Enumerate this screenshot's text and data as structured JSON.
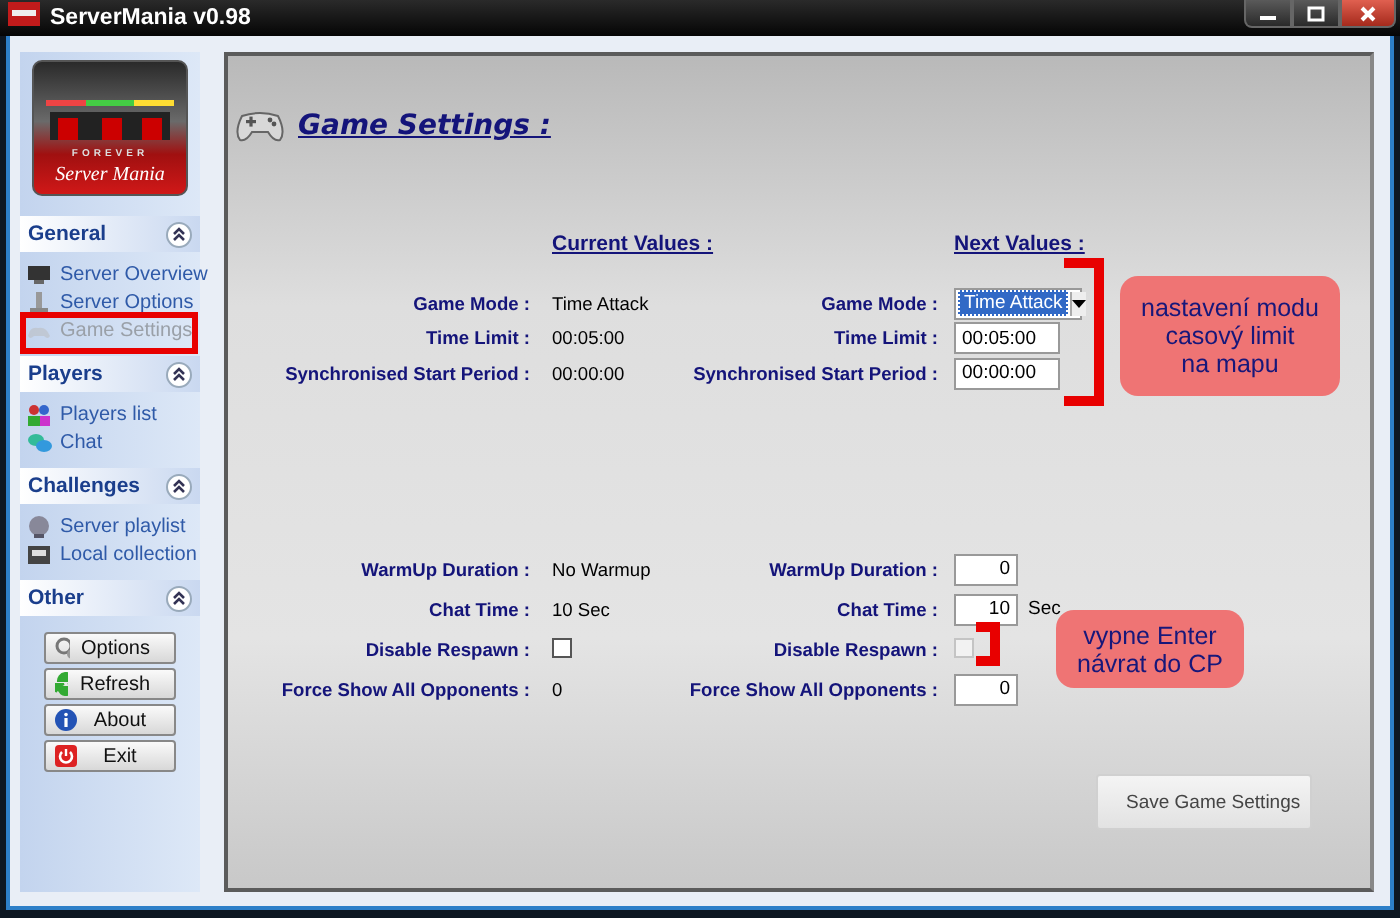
{
  "window": {
    "title": "ServerMania v0.98"
  },
  "sidebar": {
    "logo": {
      "tagline": "FOREVER",
      "name": "Server Mania"
    },
    "sections": [
      {
        "title": "General",
        "expanded": true,
        "items": [
          {
            "label": "Server Overview",
            "disabled": false
          },
          {
            "label": "Server Options",
            "disabled": false
          },
          {
            "label": "Game Settings",
            "disabled": true
          }
        ]
      },
      {
        "title": "Players",
        "expanded": true,
        "items": [
          {
            "label": "Players list",
            "disabled": false
          },
          {
            "label": "Chat",
            "disabled": false
          }
        ]
      },
      {
        "title": "Challenges",
        "expanded": true,
        "items": [
          {
            "label": "Server playlist",
            "disabled": false
          },
          {
            "label": "Local collection",
            "disabled": false
          }
        ]
      },
      {
        "title": "Other",
        "expanded": true,
        "buttons": [
          "Options",
          "Refresh",
          "About",
          "Exit"
        ]
      }
    ]
  },
  "page": {
    "title": "Game Settings :",
    "current_heading": "Current Values :",
    "next_heading": "Next Values :",
    "groups": [
      {
        "rows": [
          {
            "current": {
              "label": "Game Mode :",
              "kind": "text",
              "value": "Time Attack"
            },
            "next": {
              "label": "Game Mode :",
              "kind": "dropdown",
              "value": "Time Attack"
            }
          },
          {
            "current": {
              "label": "Time Limit :",
              "kind": "text",
              "value": "00:05:00"
            },
            "next": {
              "label": "Time Limit :",
              "kind": "input",
              "value": "00:05:00"
            }
          },
          {
            "current": {
              "label": "Synchronised Start Period :",
              "kind": "text",
              "value": "00:00:00"
            },
            "next": {
              "label": "Synchronised Start Period :",
              "kind": "input",
              "value": "00:00:00"
            }
          }
        ]
      },
      {
        "rows": [
          {
            "current": {
              "label": "WarmUp Duration :",
              "kind": "text",
              "value": "No Warmup"
            },
            "next": {
              "label": "WarmUp Duration :",
              "kind": "number",
              "value": "0"
            }
          },
          {
            "current": {
              "label": "Chat Time :",
              "kind": "text",
              "value": "10 Sec"
            },
            "next": {
              "label": "Chat Time :",
              "kind": "number",
              "value": "10",
              "unit": "Sec"
            }
          },
          {
            "current": {
              "label": "Disable Respawn :",
              "kind": "checkbox",
              "checked": false
            },
            "next": {
              "label": "Disable Respawn :",
              "kind": "checkbox",
              "checked": false,
              "disabled": true
            }
          },
          {
            "current": {
              "label": "Force Show All Opponents :",
              "kind": "text",
              "value": "0"
            },
            "next": {
              "label": "Force Show All Opponents :",
              "kind": "number",
              "value": "0"
            }
          }
        ]
      }
    ],
    "save_button": "Save Game Settings"
  },
  "annotations": [
    {
      "kind": "frame"
    },
    {
      "kind": "callout",
      "text": "nastavení modu\ncasový limit\nna mapu"
    },
    {
      "kind": "callout",
      "text": "vypne Enter\nnávrat do CP"
    }
  ]
}
